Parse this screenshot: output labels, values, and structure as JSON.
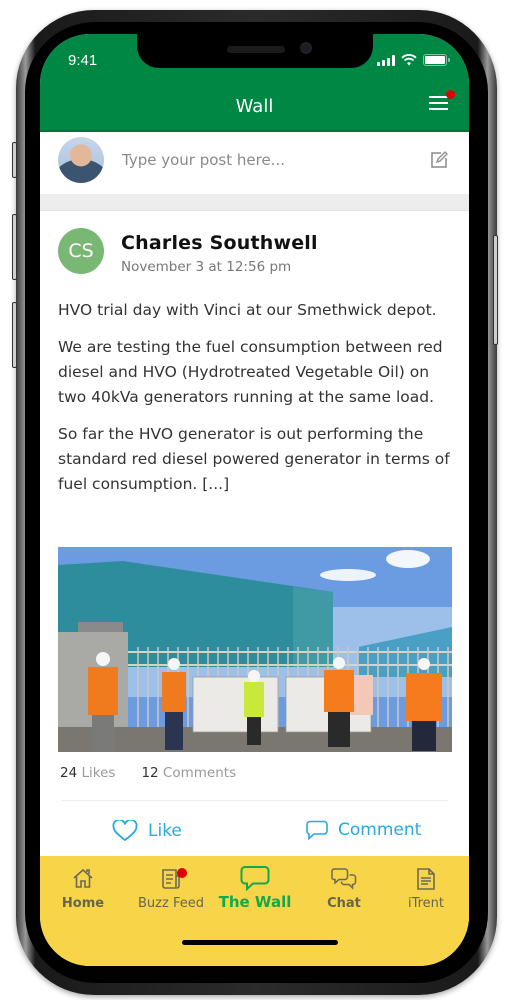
{
  "status_bar": {
    "time": "9:41"
  },
  "header": {
    "title": "Wall",
    "menu_has_notification": true
  },
  "composer": {
    "placeholder": "Type your post here..."
  },
  "post": {
    "author_initials": "CS",
    "author_name": "Charles Southwell",
    "date": "November 3 at 12:56 pm",
    "paragraphs": [
      "HVO trial day with Vinci at our Smethwick depot.",
      "We are testing the fuel consumption between red diesel and HVO (Hydrotreated Vegetable Oil) on two 40kVa generators running at the same load.",
      "So far the HVO generator is out performing the standard red diesel powered generator in terms of fuel consumption. [...]"
    ],
    "image_alt": "Group of workers in hi-vis vests and hard hats standing beside two generators in front of a blue warehouse",
    "likes_count": "24",
    "likes_label": "Likes",
    "comments_count": "12",
    "comments_label": "Comments",
    "like_action": "Like",
    "comment_action": "Comment"
  },
  "tabbar": {
    "tabs": [
      {
        "label": "Home",
        "icon": "home-icon",
        "active": false
      },
      {
        "label": "Buzz Feed",
        "icon": "newspaper-icon",
        "active": false,
        "has_notification": true
      },
      {
        "label": "The Wall",
        "icon": "speech-bubble-icon",
        "active": true
      },
      {
        "label": "Chat",
        "icon": "chat-bubbles-icon",
        "active": false
      },
      {
        "label": "iTrent",
        "icon": "document-icon",
        "active": false
      }
    ]
  },
  "colors": {
    "header_green": "#008744",
    "accent_blue": "#27a8e0",
    "tabbar_yellow": "#f7d448",
    "active_tab_green": "#14a84a",
    "notification_red": "#e00000",
    "avatar_green": "#78b874"
  }
}
